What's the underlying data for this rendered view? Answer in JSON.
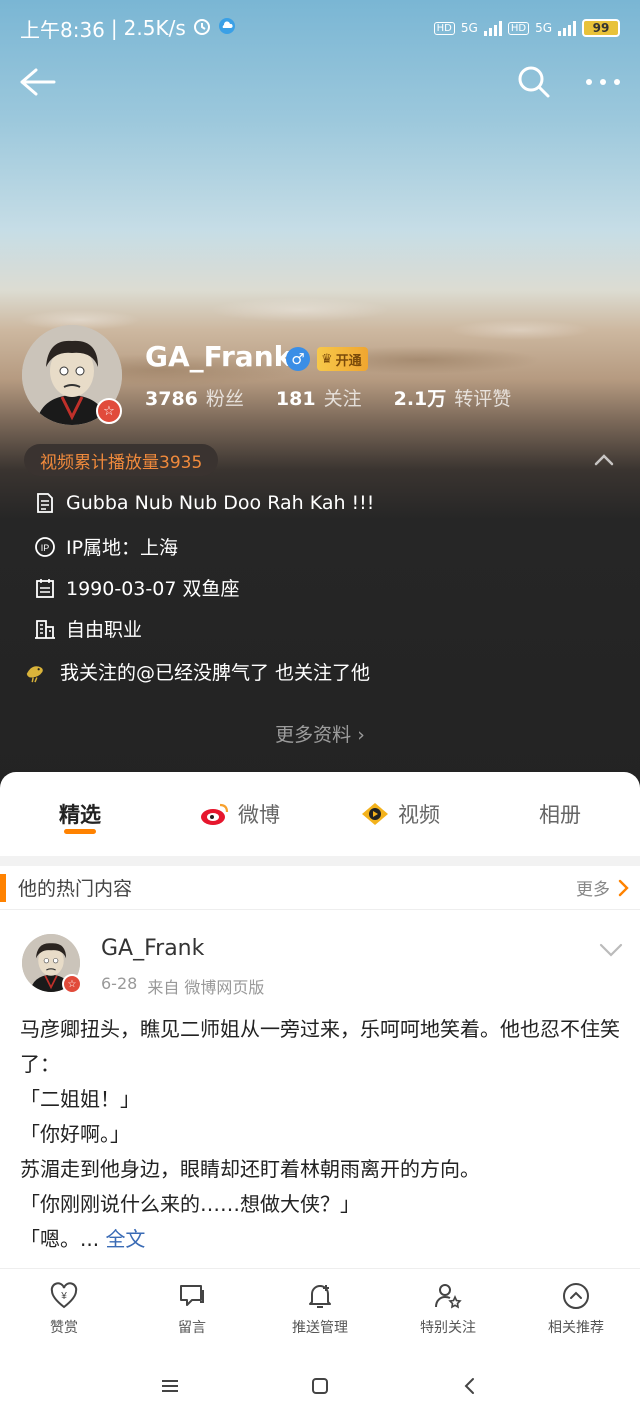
{
  "status_bar": {
    "time": "上午8:36",
    "speed": "2.5K/s",
    "battery": "99",
    "network_1": "5G",
    "network_2": "5G",
    "hd_1": "HD",
    "hd_2": "HD"
  },
  "profile": {
    "name": "GA_Frank",
    "vip_label": "开通",
    "followers_count": "3786",
    "followers_label": "粉丝",
    "following_count": "181",
    "following_label": "关注",
    "likes_count": "2.1万",
    "likes_label": "转评赞",
    "video_plays": "视频累计播放量3935",
    "bio": "Gubba Nub Nub Doo Rah Kah !!!",
    "ip_location": "IP属地：上海",
    "birthday": "1990-03-07 双鱼座",
    "occupation": "自由职业",
    "mutual_follow": "我关注的@已经没脾气了 也关注了他",
    "more_info": "更多资料 ›"
  },
  "tabs": [
    {
      "label": "精选",
      "active": true
    },
    {
      "label": "微博",
      "active": false
    },
    {
      "label": "视频",
      "active": false
    },
    {
      "label": "相册",
      "active": false
    }
  ],
  "hot_section": {
    "title": "他的热门内容",
    "more": "更多"
  },
  "post": {
    "author": "GA_Frank",
    "date": "6-28",
    "source": "来自 微博网页版",
    "lines": [
      "马彦卿扭头，瞧见二师姐从一旁过来，乐呵呵地笑着。他也忍不住笑了：",
      "「二姐姐！」",
      "「你好啊。」",
      "苏湄走到他身边，眼睛却还盯着林朝雨离开的方向。",
      "「你刚刚说什么来的……想做大侠？」"
    ],
    "last_line": "「嗯。...",
    "full_text": "全文"
  },
  "actions": [
    {
      "label": "赞赏",
      "icon": "reward-icon"
    },
    {
      "label": "留言",
      "icon": "message-icon"
    },
    {
      "label": "推送管理",
      "icon": "bell-icon"
    },
    {
      "label": "特别关注",
      "icon": "special-follow-icon"
    },
    {
      "label": "相关推荐",
      "icon": "recommend-icon"
    }
  ],
  "colors": {
    "accent": "#ff8200",
    "link": "#3a6bb5",
    "video_text": "#f08a3c"
  }
}
